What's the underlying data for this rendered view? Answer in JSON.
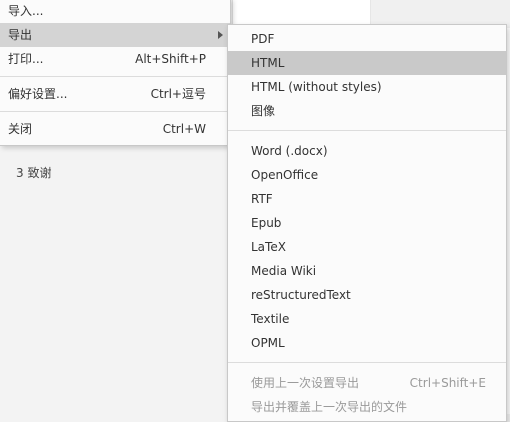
{
  "outline": {
    "item_3": "3 致谢"
  },
  "file_menu": {
    "items": [
      {
        "label": "导入..."
      },
      {
        "label": "导出"
      },
      {
        "label": "打印...",
        "shortcut": "Alt+Shift+P"
      },
      {
        "label": "偏好设置...",
        "shortcut": "Ctrl+逗号"
      },
      {
        "label": "关闭",
        "shortcut": "Ctrl+W"
      }
    ]
  },
  "export_menu": {
    "items": [
      {
        "label": "PDF"
      },
      {
        "label": "HTML"
      },
      {
        "label": "HTML (without styles)"
      },
      {
        "label": "图像"
      },
      {
        "label": "Word (.docx)"
      },
      {
        "label": "OpenOffice"
      },
      {
        "label": "RTF"
      },
      {
        "label": "Epub"
      },
      {
        "label": "LaTeX"
      },
      {
        "label": "Media Wiki"
      },
      {
        "label": "reStructuredText"
      },
      {
        "label": "Textile"
      },
      {
        "label": "OPML"
      },
      {
        "label": "使用上一次设置导出",
        "shortcut": "Ctrl+Shift+E"
      },
      {
        "label": "导出并覆盖上一次导出的文件"
      }
    ]
  }
}
